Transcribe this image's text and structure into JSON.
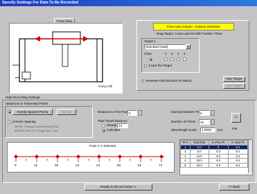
{
  "window": {
    "title": "Specify Settings For Data To Be Recorded"
  },
  "top_view": {
    "tab": "Front View",
    "left_label": "Curvy Hill",
    "marker": "F"
  },
  "target_panel": {
    "banner": "Free-Axis Column : Column Size/Size",
    "instruction": "Drag Target, Leave and Scrollle Position Them",
    "group_label": "Target 1",
    "dropdown_value": "[Standard Data]",
    "chan_label": "Chan",
    "chan_options": [
      "1",
      "2",
      "3",
      "4"
    ],
    "invert_label": "Invert the Target",
    "reverse_label": "Reverse Pull Direction of Motion",
    "new_target": "New Target",
    "delete_target": "Del. Target",
    "colors": {
      "banner_bg": "#ffff00"
    }
  },
  "recording": {
    "group_label": "Data Recording Settings",
    "spacing_group": "Distances to Traversed Points",
    "evenly_label": "Evenly Spaced Points",
    "setup_label": "Set up",
    "uneven_label": "Uneven Spacing",
    "uneven_note1": "MORE: Change Column Drag Point",
    "uneven_note2": "INSERT/ DELETE Target Dist Cont",
    "distance_first_label": "Distance to First Point",
    "distance_first_value": "0",
    "total_label": "Total Travel Distance",
    "steady_label": "Steady",
    "steady_value": "14",
    "calculate_label": "Calculate",
    "interval_label": "Interval between Points",
    "interval_value": "6",
    "num_points_label": "Number of Points",
    "num_points_value": "10",
    "wavelength_label": "Wavelength Scale",
    "wavelength_value": "1.0000",
    "wavelength_unit": "mm",
    "check_label": "Insr",
    "points_label": "Point T: 0   Selected",
    "ruler_ticks": [
      "0",
      "12",
      "20",
      "34",
      "44",
      "50",
      "62",
      "72"
    ],
    "table_headers": [
      "Pt #",
      "Total Dist",
      "In Prev Pt",
      "In Next Pt"
    ],
    "table_rows": [
      [
        "1",
        "0.0",
        "0",
        "6.2"
      ],
      [
        "2",
        "6.0",
        "6.3",
        "6.2"
      ],
      [
        "3",
        "12.0",
        "6.3",
        "6.2"
      ],
      [
        "4",
        "18.0",
        "6.3",
        "6.2"
      ],
      [
        "5",
        "24.0",
        "6.3",
        "6.2"
      ]
    ]
  },
  "footer": {
    "ready_button": "Ready to Record Data >>",
    "back_button": "<< Back"
  }
}
